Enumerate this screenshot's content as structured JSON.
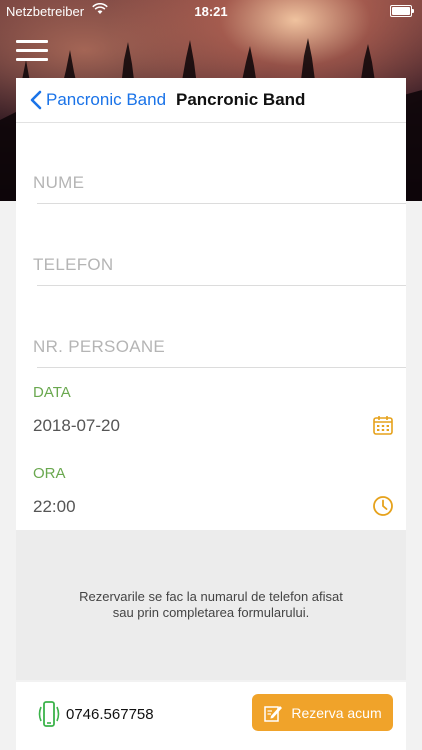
{
  "status_bar": {
    "carrier": "Netzbetreiber",
    "time": "18:21"
  },
  "nav": {
    "back_label": "Pancronic Band",
    "title": "Pancronic Band"
  },
  "form": {
    "name_placeholder": "NUME",
    "phone_placeholder": "TELEFON",
    "persons_placeholder": "NR. PERSOANE",
    "date_label": "DATA",
    "date_value": "2018-07-20",
    "time_label": "ORA",
    "time_value": "22:00"
  },
  "info": {
    "line1": "Rezervarile se fac la numarul de telefon afisat",
    "line2": "sau prin completarea formularului."
  },
  "footer": {
    "phone_number": "0746.567758",
    "reserve_button": "Rezerva acum"
  },
  "colors": {
    "accent_blue": "#1a73e8",
    "accent_green": "#6aa84f",
    "accent_orange": "#f0a32a"
  },
  "icons": [
    "wifi-icon",
    "battery-icon",
    "menu-icon",
    "chevron-left-icon",
    "calendar-icon",
    "clock-icon",
    "phone-icon",
    "edit-icon"
  ]
}
